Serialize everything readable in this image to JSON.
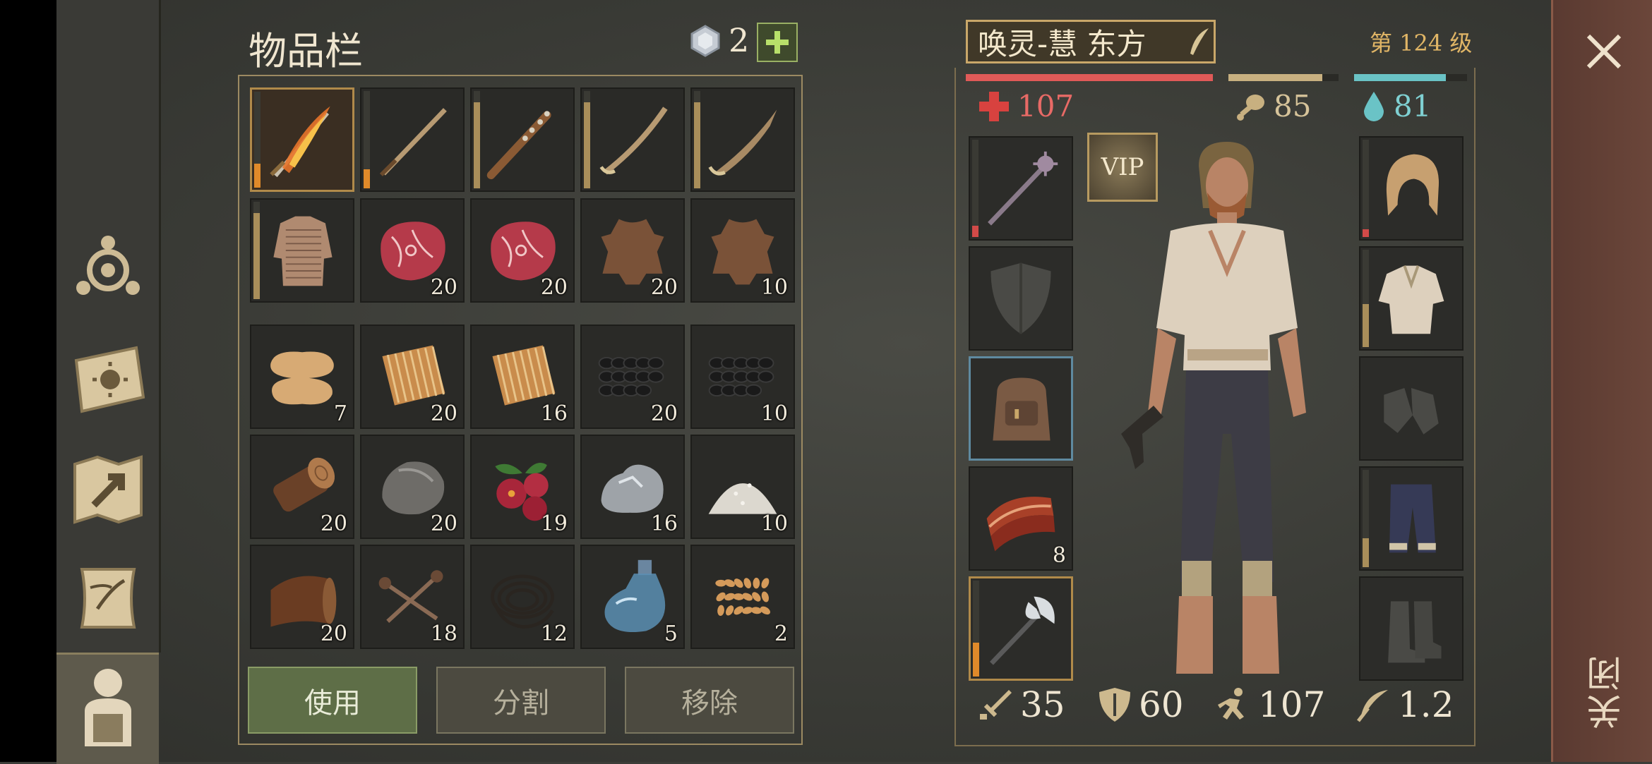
{
  "inventory": {
    "title": "物品栏",
    "gem_count": "2",
    "slots": [
      {
        "name": "flaming-sword",
        "count": "",
        "durability": 0.25,
        "selected": true
      },
      {
        "name": "long-sword",
        "count": "",
        "durability": 0.2
      },
      {
        "name": "spiked-club",
        "count": "",
        "durability": 0.9
      },
      {
        "name": "saber",
        "count": "",
        "durability": 0.9
      },
      {
        "name": "machete",
        "count": "",
        "durability": 0.9
      },
      {
        "name": "chainmail-shirt",
        "count": "",
        "durability": 0.9
      },
      {
        "name": "raw-meat",
        "count": "20"
      },
      {
        "name": "raw-meat",
        "count": "20"
      },
      {
        "name": "animal-hide",
        "count": "20"
      },
      {
        "name": "animal-hide",
        "count": "10"
      },
      {
        "name": "cloth",
        "count": "7"
      },
      {
        "name": "fiber",
        "count": "20"
      },
      {
        "name": "fiber",
        "count": "16"
      },
      {
        "name": "coal",
        "count": "20"
      },
      {
        "name": "coal",
        "count": "10"
      },
      {
        "name": "wood-log",
        "count": "20"
      },
      {
        "name": "stone",
        "count": "20"
      },
      {
        "name": "berries",
        "count": "19"
      },
      {
        "name": "iron-ore",
        "count": "16"
      },
      {
        "name": "salt",
        "count": "10"
      },
      {
        "name": "leather",
        "count": "20"
      },
      {
        "name": "nails",
        "count": "18"
      },
      {
        "name": "rope",
        "count": "12"
      },
      {
        "name": "water-bottle",
        "count": "5"
      },
      {
        "name": "seeds",
        "count": "2"
      }
    ],
    "buttons": {
      "use": "使用",
      "split": "分割",
      "remove": "移除"
    }
  },
  "character": {
    "name": "唤灵-慧 东方",
    "level": "第 124 级",
    "health": "107",
    "food": "85",
    "water": "81",
    "health_fill": 1.0,
    "food_fill": 0.85,
    "water_fill": 0.81,
    "vip_label": "VIP",
    "equip_left": [
      {
        "name": "mace",
        "count": ""
      },
      {
        "name": "shield-empty",
        "count": ""
      },
      {
        "name": "backpack",
        "count": ""
      },
      {
        "name": "bacon",
        "count": "8"
      },
      {
        "name": "battle-axe",
        "count": ""
      }
    ],
    "equip_right": [
      {
        "name": "hood"
      },
      {
        "name": "shirt"
      },
      {
        "name": "gloves-empty"
      },
      {
        "name": "pants"
      },
      {
        "name": "boots-empty"
      }
    ],
    "stats": {
      "attack": "35",
      "defense": "60",
      "speed": "107",
      "weight": "1.2"
    }
  },
  "close_label": "关闭",
  "colors": {
    "health": "#e05a58",
    "food": "#c8b080",
    "water": "#6ac3c6",
    "accent": "#c9a769"
  }
}
